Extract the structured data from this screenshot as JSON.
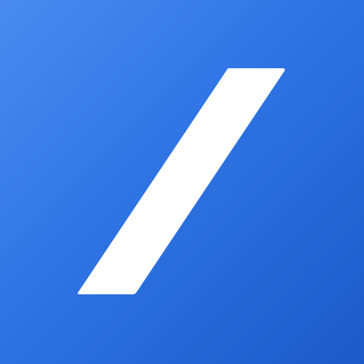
{
  "icon": {
    "name": "slash-logo-icon",
    "colors": {
      "background_start": "#4a8bf0",
      "background_mid": "#2f74e4",
      "background_end": "#1c59c8",
      "mark": "#ffffff"
    }
  }
}
